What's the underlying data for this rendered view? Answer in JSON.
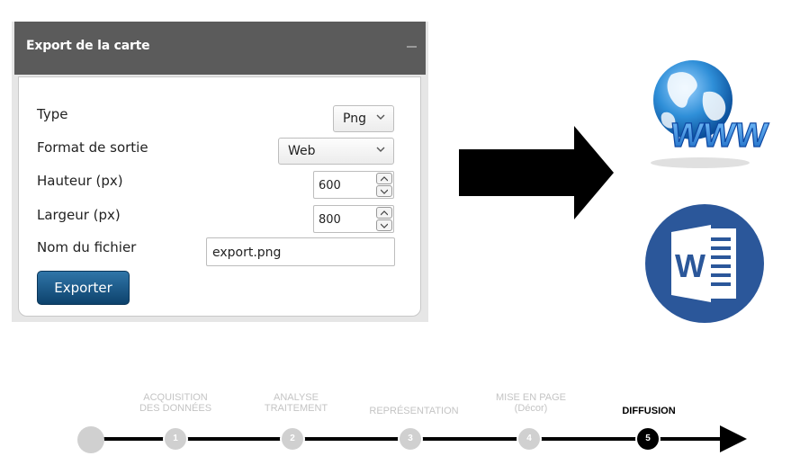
{
  "panel": {
    "title": "Export de la carte",
    "fields": {
      "type": {
        "label": "Type",
        "value": "Png"
      },
      "format": {
        "label": "Format de sortie",
        "value": "Web"
      },
      "height": {
        "label": "Hauteur (px)",
        "value": "600"
      },
      "width": {
        "label": "Largeur (px)",
        "value": "800"
      },
      "filename": {
        "label": "Nom du fichier",
        "value": "export.png"
      }
    },
    "export_button": "Exporter"
  },
  "icons": {
    "arrow": "right-arrow-icon",
    "web": "www-globe-icon",
    "word": "microsoft-word-icon",
    "word_letter": "W",
    "web_text": "WWW"
  },
  "timeline": {
    "steps": [
      {
        "number": "",
        "label1": "",
        "label2": ""
      },
      {
        "number": "1",
        "label1": "ACQUISITION",
        "label2": "DES DONNÉES"
      },
      {
        "number": "2",
        "label1": "ANALYSE",
        "label2": "TRAITEMENT"
      },
      {
        "number": "3",
        "label1": "REPRÉSENTATION",
        "label2": ""
      },
      {
        "number": "4",
        "label1": "MISE EN PAGE",
        "label2": "(Décor)"
      },
      {
        "number": "5",
        "label1": "DIFFUSION",
        "label2": ""
      }
    ],
    "active_step": "5"
  },
  "colors": {
    "panel_header": "#5b5b5b",
    "button_primary": "#0d426c",
    "inactive_step": "#d0d0d0",
    "word_blue": "#2b579a",
    "globe_blue": "#2f8fd8"
  }
}
